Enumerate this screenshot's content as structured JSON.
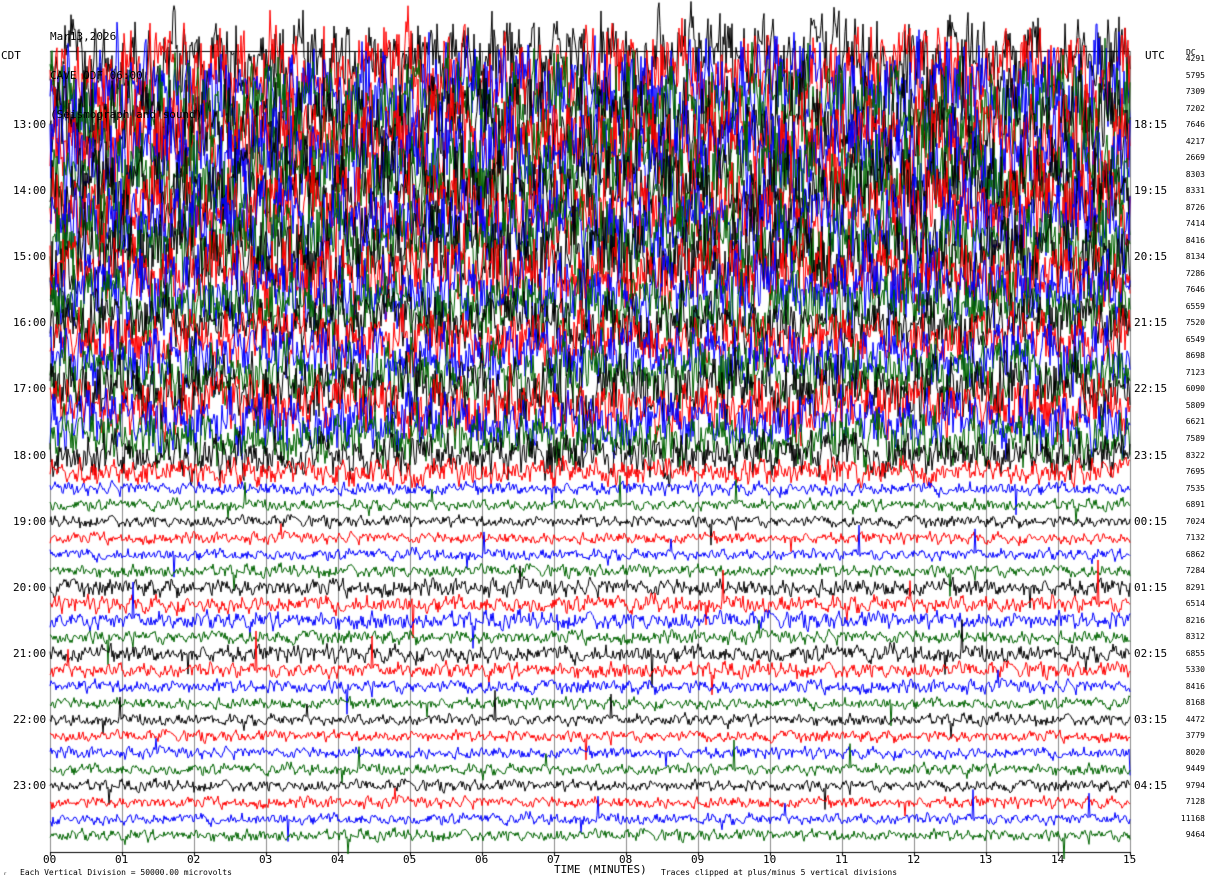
{
  "header": {
    "date": "Mar13,2026",
    "station": "CAVE ODF 06:00",
    "network": "(Seismograph and sound)"
  },
  "labels": {
    "left_tz": "CDT",
    "right_tz": "UTC",
    "dc_label": "DC"
  },
  "footer": {
    "xlabel": "TIME (MINUTES)",
    "scale_note": "Each Vertical Division = 50000.00 microvolts",
    "clip_note": "Traces clipped at plus/minus 5 vertical divisions",
    "corner_mark": "ᵣ"
  },
  "colors": {
    "trace_cycle": [
      "#000000",
      "#ff0000",
      "#0000ff",
      "#006400"
    ]
  },
  "chart_data": {
    "type": "line",
    "title": "CAVE ODF 06:00",
    "xlabel": "TIME (MINUTES)",
    "x_ticks": [
      "00",
      "01",
      "02",
      "03",
      "04",
      "05",
      "06",
      "07",
      "08",
      "09",
      "10",
      "11",
      "12",
      "13",
      "14",
      "15"
    ],
    "xlim": [
      0,
      15
    ],
    "left_hour_labels": [
      "13:00",
      "14:00",
      "15:00",
      "16:00",
      "17:00",
      "18:00",
      "19:00",
      "20:00",
      "21:00",
      "22:00",
      "23:00"
    ],
    "right_hour_labels": [
      "18:15",
      "19:15",
      "20:15",
      "21:15",
      "22:15",
      "23:15",
      "00:15",
      "01:15",
      "02:15",
      "03:15",
      "04:15"
    ],
    "dc_offsets": [
      "4291",
      "5795",
      "7309",
      "7202",
      "7646",
      "4217",
      "2669",
      "8303",
      "8331",
      "8726",
      "7414",
      "8416",
      "8134",
      "7286",
      "7646",
      "6559",
      "7520",
      "6549",
      "8698",
      "7123",
      "6090",
      "5809",
      "6621",
      "7589",
      "8322",
      "7695",
      "7535",
      "6891",
      "7024",
      "7132",
      "6862",
      "7284",
      "8291",
      "6514",
      "8216",
      "8312",
      "6855",
      "5330",
      "8416",
      "8168",
      "4472",
      "3779",
      "8020",
      "9449",
      "9794",
      "7128",
      "11168",
      "9464"
    ],
    "trace_amplitude_divisions": [
      2.2,
      2.4,
      2.6,
      2.6,
      2.6,
      2.7,
      2.6,
      2.5,
      2.5,
      2.3,
      2.3,
      2.4,
      2.4,
      2.0,
      1.9,
      1.8,
      1.6,
      1.5,
      1.7,
      1.6,
      1.8,
      1.6,
      1.5,
      1.4,
      1.1,
      0.7,
      0.35,
      0.3,
      0.3,
      0.3,
      0.3,
      0.32,
      0.45,
      0.45,
      0.45,
      0.35,
      0.45,
      0.4,
      0.35,
      0.3,
      0.3,
      0.3,
      0.3,
      0.3,
      0.3,
      0.3,
      0.3,
      0.3
    ],
    "clip_divisions": 5,
    "grid": true
  }
}
